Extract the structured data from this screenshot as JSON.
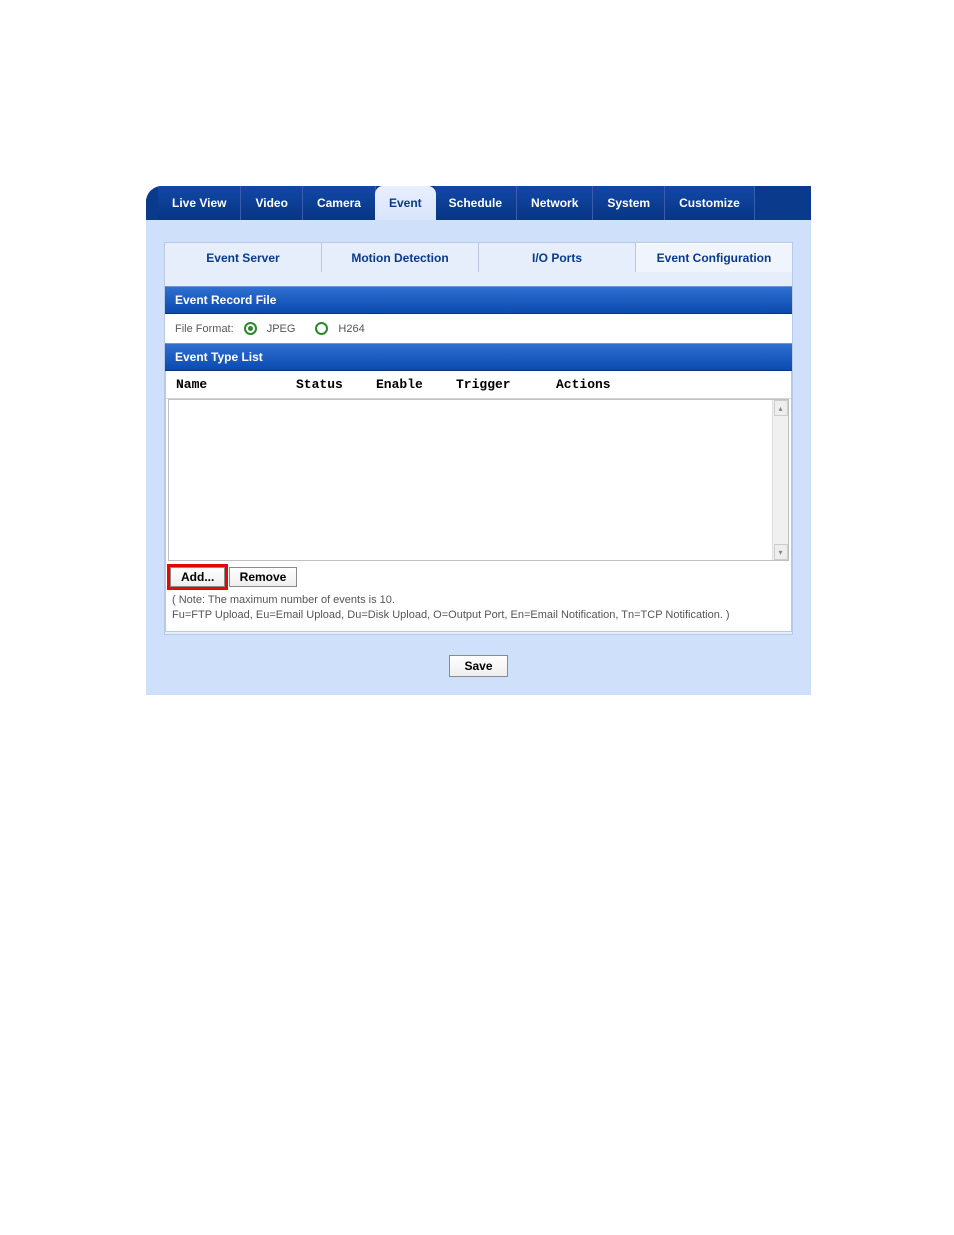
{
  "topnav": {
    "items": [
      "Live View",
      "Video",
      "Camera",
      "Event",
      "Schedule",
      "Network",
      "System",
      "Customize"
    ],
    "active_index": 3
  },
  "subtabs": {
    "items": [
      "Event Server",
      "Motion Detection",
      "I/O Ports",
      "Event Configuration"
    ],
    "active_index": 3
  },
  "sections": {
    "record_file": "Event Record File",
    "type_list": "Event Type List"
  },
  "file_format": {
    "label": "File Format:",
    "options": [
      {
        "label": "JPEG",
        "checked": true
      },
      {
        "label": "H264",
        "checked": false
      }
    ]
  },
  "columns": {
    "name": "Name",
    "status": "Status",
    "enable": "Enable",
    "trigger": "Trigger",
    "actions": "Actions"
  },
  "buttons": {
    "add": "Add...",
    "remove": "Remove",
    "save": "Save"
  },
  "note_line1": "( Note: The maximum number of events is 10.",
  "note_line2": " Fu=FTP Upload, Eu=Email Upload, Du=Disk Upload, O=Output Port, En=Email Notification, Tn=TCP Notification. )",
  "colors": {
    "nav_dark": "#0a3a8c",
    "panel_bg": "#cfe0fb",
    "band_blue": "#0b4aaf",
    "highlight_red": "#e30808"
  }
}
